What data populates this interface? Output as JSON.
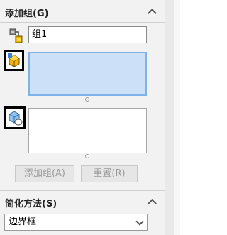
{
  "add_group": {
    "title": "添加组(G)",
    "name_value": "组1",
    "add_button": "添加组(A)",
    "reset_button": "重置(R)"
  },
  "simplify": {
    "title": "简化方法(S)",
    "selected_option": "边界框"
  },
  "colors": {
    "panel_bg": "#f2f2f2",
    "active_list_bg": "#cce1f7",
    "active_list_border": "#7fb3e8"
  },
  "icons": [
    "collapse-chevron-icon",
    "group-parts-icon",
    "component-selection-icon",
    "body-selection-icon",
    "annotation-arrow-icon",
    "dropdown-chevron-icon"
  ]
}
